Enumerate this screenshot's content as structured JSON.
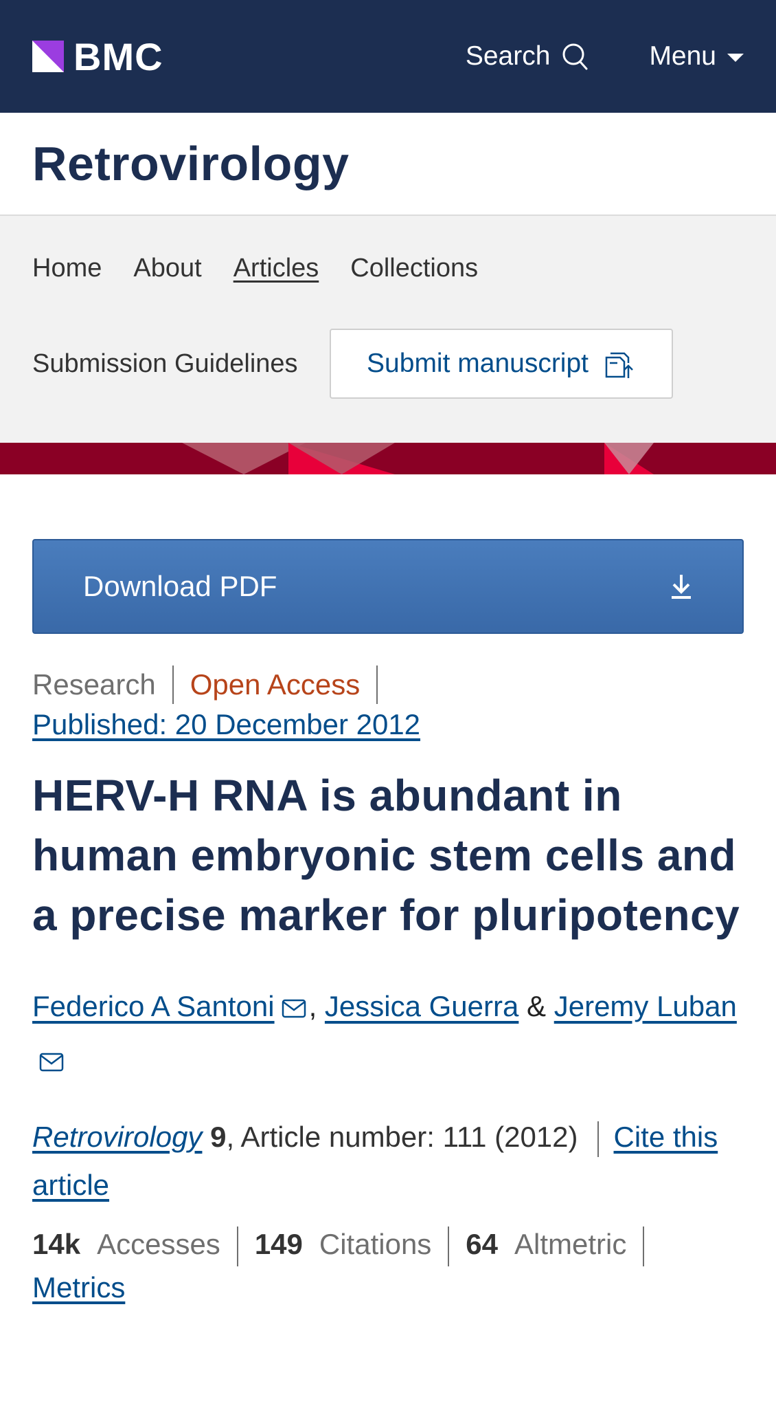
{
  "header": {
    "logo_text": "BMC",
    "search_label": "Search",
    "menu_label": "Menu"
  },
  "journal": {
    "title": "Retrovirology"
  },
  "nav": {
    "items": [
      "Home",
      "About",
      "Articles",
      "Collections"
    ],
    "active": "Articles",
    "submission_guidelines": "Submission Guidelines",
    "submit_label": "Submit manuscript"
  },
  "article": {
    "download_label": "Download PDF",
    "type": "Research",
    "access": "Open Access",
    "published": "Published: 20 December 2012",
    "title": "HERV-H RNA is abundant in human embryonic stem cells and a precise marker for pluripotency",
    "authors": [
      "Federico A Santoni",
      "Jessica Guerra",
      "Jeremy Luban"
    ],
    "author_sep_comma": ",",
    "author_sep_and": "&",
    "citation": {
      "journal": "Retrovirology",
      "volume": "9",
      "details": ", Article number: 111 (2012)",
      "cite_label": "Cite this article"
    },
    "metrics": {
      "accesses_value": "14k",
      "accesses_label": "Accesses",
      "citations_value": "149",
      "citations_label": "Citations",
      "altmetric_value": "64",
      "altmetric_label": "Altmetric",
      "metrics_link": "Metrics"
    }
  },
  "colors": {
    "header_bg": "#1c2e51",
    "band_red": "#8a0025",
    "link_blue": "#024d8b",
    "open_access": "#b7441a",
    "download_blue": "#3969a8"
  }
}
